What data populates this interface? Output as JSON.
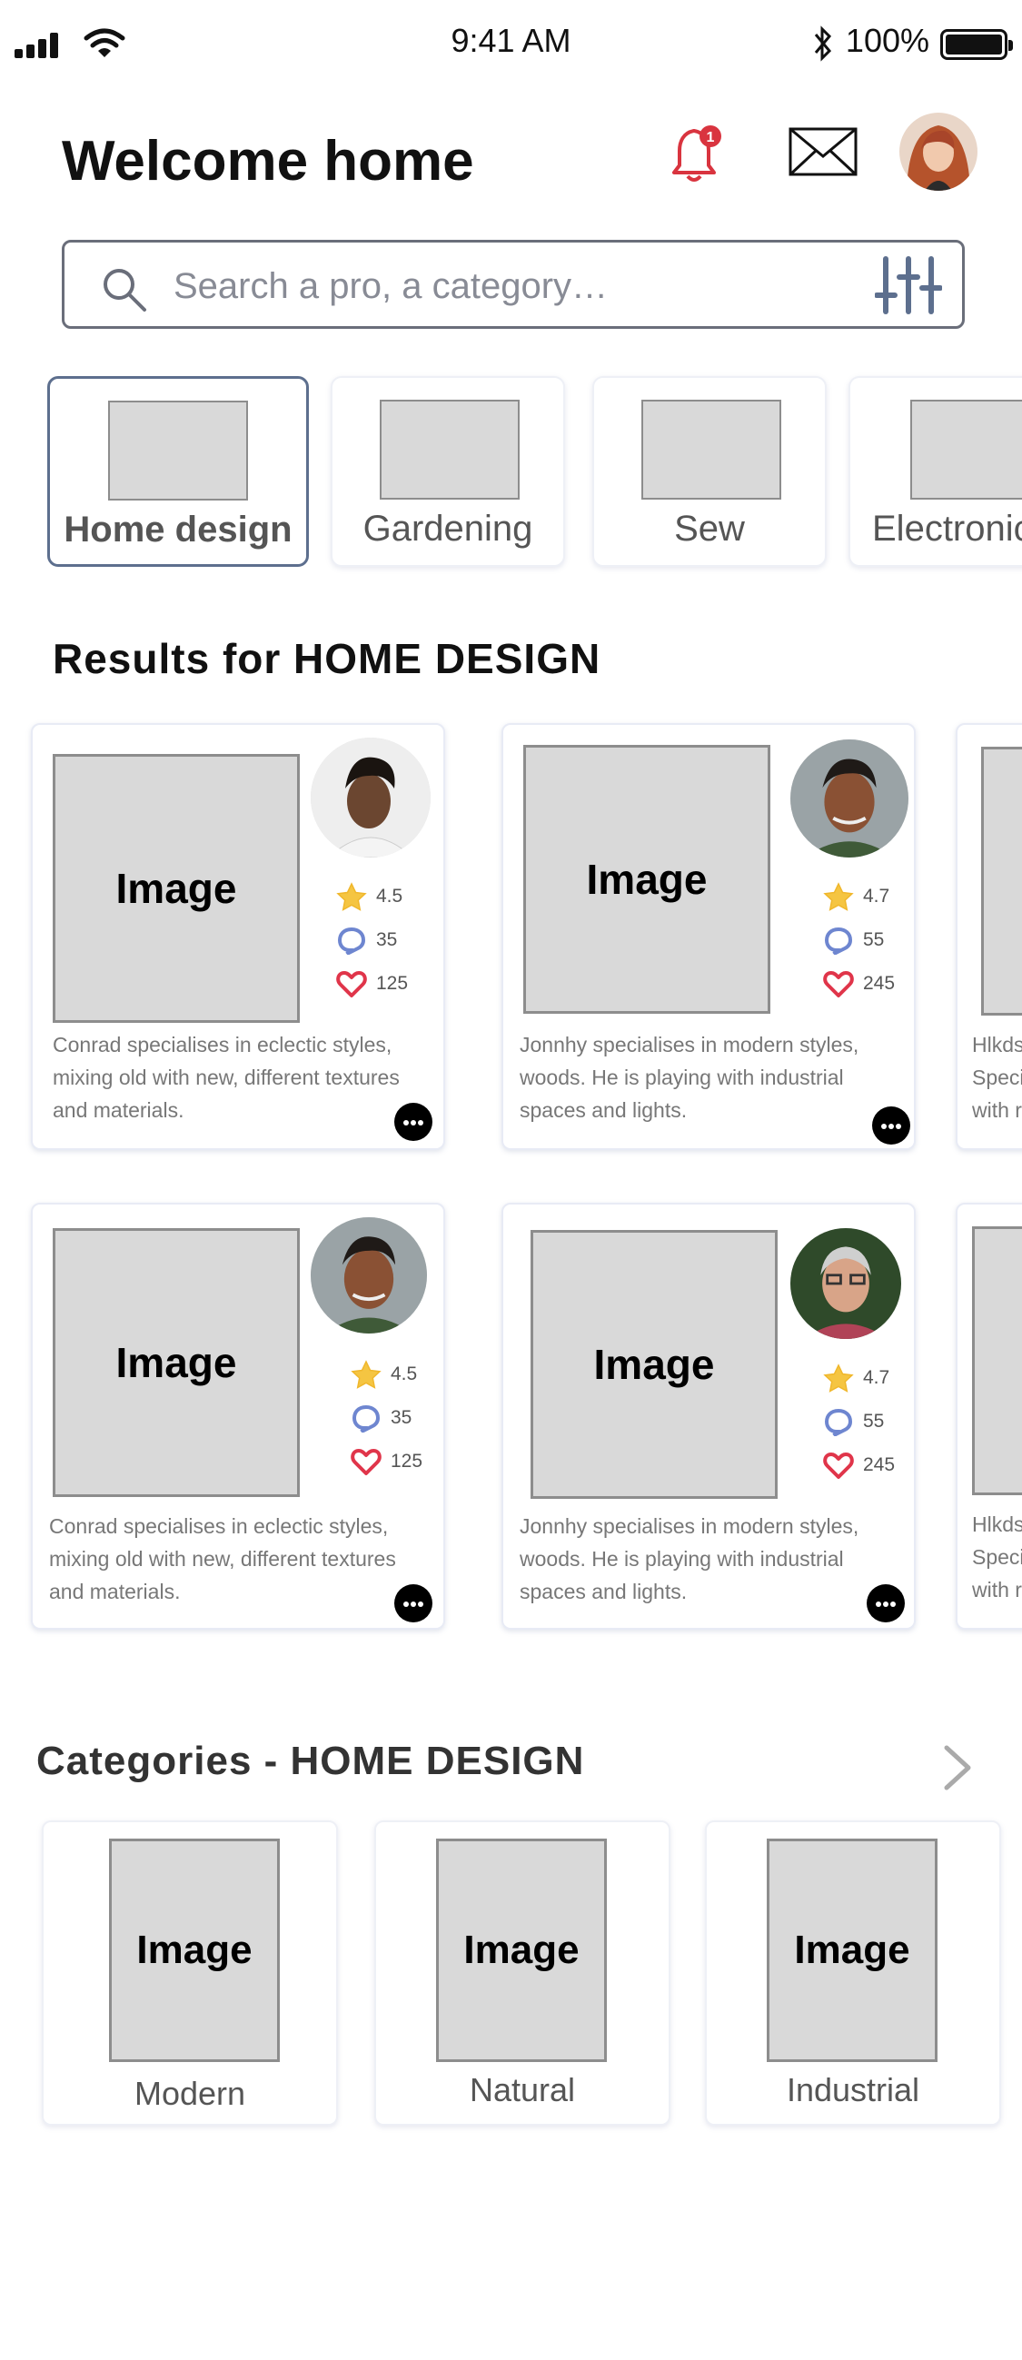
{
  "status_bar": {
    "time": "9:41 AM",
    "battery": "100%",
    "icons": [
      "signal-icon",
      "wifi-icon",
      "bluetooth-icon",
      "battery-icon"
    ]
  },
  "header": {
    "title": "Welcome home",
    "notification_count": "1"
  },
  "search": {
    "placeholder": "Search a pro, a category…"
  },
  "categories": [
    {
      "label": "Home design",
      "active": true
    },
    {
      "label": "Gardening",
      "active": false
    },
    {
      "label": "Sew",
      "active": false
    },
    {
      "label": "Electronics",
      "active": false
    }
  ],
  "results_title": "Results for HOME DESIGN",
  "pros": [
    {
      "image_label": "Image",
      "rating": "4.5",
      "comments": "35",
      "likes": "125",
      "description": "Conrad specialises in eclectic styles, mixing old with new, different textures and materials."
    },
    {
      "image_label": "Image",
      "rating": "4.7",
      "comments": "55",
      "likes": "245",
      "description": "Jonnhy specialises in modern styles, woods. He is playing with industrial spaces and lights."
    },
    {
      "image_label": "Image",
      "rating": "4.5",
      "comments": "35",
      "likes": "125",
      "description": "Conrad specialises in eclectic styles, mixing old with new, different textures and materials."
    },
    {
      "image_label": "Image",
      "rating": "4.7",
      "comments": "55",
      "likes": "245",
      "description": "Jonnhy specialises in modern styles, woods. He is playing with industrial spaces and lights."
    }
  ],
  "peek_text": "Hlkds\nSpeci\nwith r",
  "categories_section": {
    "title": "Categories - HOME DESIGN",
    "tiles": [
      {
        "image_label": "Image",
        "label": "Modern"
      },
      {
        "image_label": "Image",
        "label": "Natural"
      },
      {
        "image_label": "Image",
        "label": "Industrial"
      }
    ]
  },
  "colors": {
    "accent": "#5d6f8e",
    "star": "#f5c542",
    "comment": "#6e86d0",
    "heart": "#e0354a",
    "bell": "#d9343f"
  }
}
